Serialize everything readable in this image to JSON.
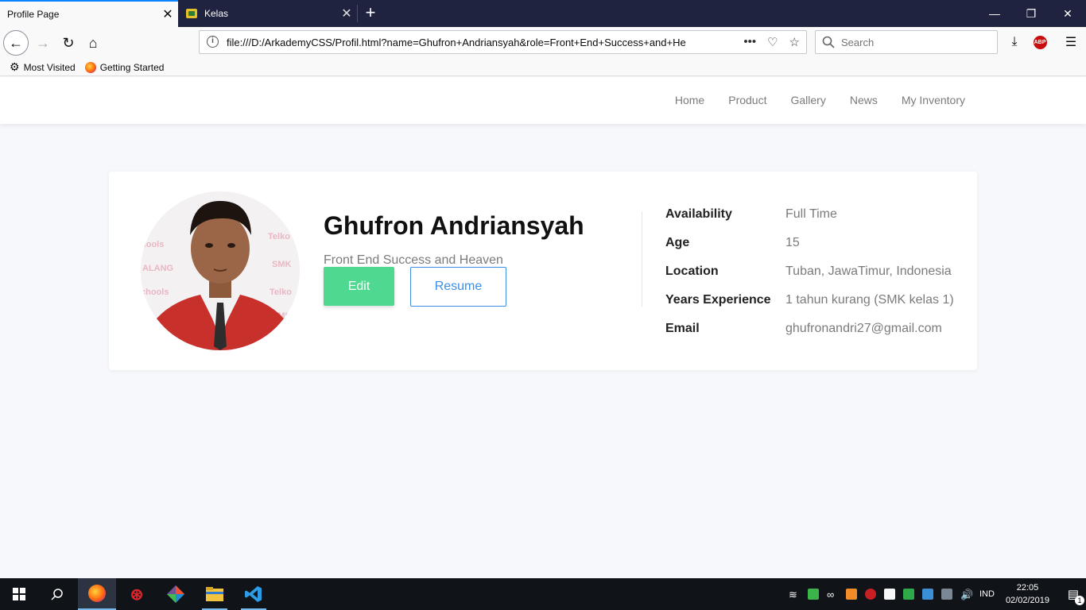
{
  "browser": {
    "tabs": [
      {
        "title": "Profile Page",
        "active": true
      },
      {
        "title": "Kelas",
        "active": false
      }
    ],
    "url": "file:///D:/ArkademyCSS/Profil.html?name=Ghufron+Andriansyah&role=Front+End+Success+and+He",
    "search_placeholder": "Search",
    "bookmarks": [
      "Most Visited",
      "Getting Started"
    ],
    "abp_label": "ABP"
  },
  "site": {
    "nav": [
      "Home",
      "Product",
      "Gallery",
      "News",
      "My Inventory"
    ]
  },
  "profile": {
    "name": "Ghufron Andriansyah",
    "role": "Front End Success and Heaven",
    "edit_label": "Edit",
    "resume_label": "Resume",
    "details": [
      {
        "label": "Availability",
        "value": "Full Time"
      },
      {
        "label": "Age",
        "value": "15"
      },
      {
        "label": "Location",
        "value": "Tuban, JawaTimur, Indonesia"
      },
      {
        "label": "Years Experience",
        "value": "1 tahun kurang (SMK kelas 1)"
      },
      {
        "label": "Email",
        "value": "ghufronandri27@gmail.com"
      }
    ]
  },
  "taskbar": {
    "language": "IND",
    "time": "22:05",
    "date": "02/02/2019",
    "notification_count": "1"
  }
}
